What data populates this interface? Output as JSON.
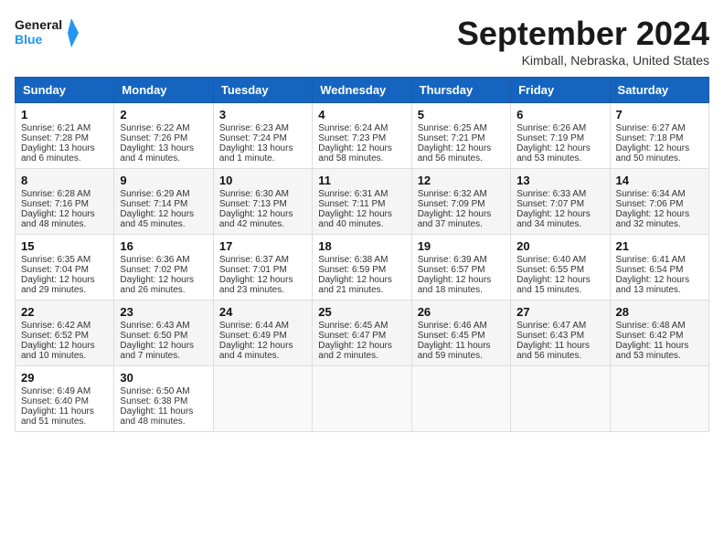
{
  "header": {
    "logo_line1": "General",
    "logo_line2": "Blue",
    "month": "September 2024",
    "location": "Kimball, Nebraska, United States"
  },
  "days_of_week": [
    "Sunday",
    "Monday",
    "Tuesday",
    "Wednesday",
    "Thursday",
    "Friday",
    "Saturday"
  ],
  "weeks": [
    [
      {
        "day": "1",
        "sunrise": "Sunrise: 6:21 AM",
        "sunset": "Sunset: 7:28 PM",
        "daylight": "Daylight: 13 hours and 6 minutes."
      },
      {
        "day": "2",
        "sunrise": "Sunrise: 6:22 AM",
        "sunset": "Sunset: 7:26 PM",
        "daylight": "Daylight: 13 hours and 4 minutes."
      },
      {
        "day": "3",
        "sunrise": "Sunrise: 6:23 AM",
        "sunset": "Sunset: 7:24 PM",
        "daylight": "Daylight: 13 hours and 1 minute."
      },
      {
        "day": "4",
        "sunrise": "Sunrise: 6:24 AM",
        "sunset": "Sunset: 7:23 PM",
        "daylight": "Daylight: 12 hours and 58 minutes."
      },
      {
        "day": "5",
        "sunrise": "Sunrise: 6:25 AM",
        "sunset": "Sunset: 7:21 PM",
        "daylight": "Daylight: 12 hours and 56 minutes."
      },
      {
        "day": "6",
        "sunrise": "Sunrise: 6:26 AM",
        "sunset": "Sunset: 7:19 PM",
        "daylight": "Daylight: 12 hours and 53 minutes."
      },
      {
        "day": "7",
        "sunrise": "Sunrise: 6:27 AM",
        "sunset": "Sunset: 7:18 PM",
        "daylight": "Daylight: 12 hours and 50 minutes."
      }
    ],
    [
      {
        "day": "8",
        "sunrise": "Sunrise: 6:28 AM",
        "sunset": "Sunset: 7:16 PM",
        "daylight": "Daylight: 12 hours and 48 minutes."
      },
      {
        "day": "9",
        "sunrise": "Sunrise: 6:29 AM",
        "sunset": "Sunset: 7:14 PM",
        "daylight": "Daylight: 12 hours and 45 minutes."
      },
      {
        "day": "10",
        "sunrise": "Sunrise: 6:30 AM",
        "sunset": "Sunset: 7:13 PM",
        "daylight": "Daylight: 12 hours and 42 minutes."
      },
      {
        "day": "11",
        "sunrise": "Sunrise: 6:31 AM",
        "sunset": "Sunset: 7:11 PM",
        "daylight": "Daylight: 12 hours and 40 minutes."
      },
      {
        "day": "12",
        "sunrise": "Sunrise: 6:32 AM",
        "sunset": "Sunset: 7:09 PM",
        "daylight": "Daylight: 12 hours and 37 minutes."
      },
      {
        "day": "13",
        "sunrise": "Sunrise: 6:33 AM",
        "sunset": "Sunset: 7:07 PM",
        "daylight": "Daylight: 12 hours and 34 minutes."
      },
      {
        "day": "14",
        "sunrise": "Sunrise: 6:34 AM",
        "sunset": "Sunset: 7:06 PM",
        "daylight": "Daylight: 12 hours and 32 minutes."
      }
    ],
    [
      {
        "day": "15",
        "sunrise": "Sunrise: 6:35 AM",
        "sunset": "Sunset: 7:04 PM",
        "daylight": "Daylight: 12 hours and 29 minutes."
      },
      {
        "day": "16",
        "sunrise": "Sunrise: 6:36 AM",
        "sunset": "Sunset: 7:02 PM",
        "daylight": "Daylight: 12 hours and 26 minutes."
      },
      {
        "day": "17",
        "sunrise": "Sunrise: 6:37 AM",
        "sunset": "Sunset: 7:01 PM",
        "daylight": "Daylight: 12 hours and 23 minutes."
      },
      {
        "day": "18",
        "sunrise": "Sunrise: 6:38 AM",
        "sunset": "Sunset: 6:59 PM",
        "daylight": "Daylight: 12 hours and 21 minutes."
      },
      {
        "day": "19",
        "sunrise": "Sunrise: 6:39 AM",
        "sunset": "Sunset: 6:57 PM",
        "daylight": "Daylight: 12 hours and 18 minutes."
      },
      {
        "day": "20",
        "sunrise": "Sunrise: 6:40 AM",
        "sunset": "Sunset: 6:55 PM",
        "daylight": "Daylight: 12 hours and 15 minutes."
      },
      {
        "day": "21",
        "sunrise": "Sunrise: 6:41 AM",
        "sunset": "Sunset: 6:54 PM",
        "daylight": "Daylight: 12 hours and 13 minutes."
      }
    ],
    [
      {
        "day": "22",
        "sunrise": "Sunrise: 6:42 AM",
        "sunset": "Sunset: 6:52 PM",
        "daylight": "Daylight: 12 hours and 10 minutes."
      },
      {
        "day": "23",
        "sunrise": "Sunrise: 6:43 AM",
        "sunset": "Sunset: 6:50 PM",
        "daylight": "Daylight: 12 hours and 7 minutes."
      },
      {
        "day": "24",
        "sunrise": "Sunrise: 6:44 AM",
        "sunset": "Sunset: 6:49 PM",
        "daylight": "Daylight: 12 hours and 4 minutes."
      },
      {
        "day": "25",
        "sunrise": "Sunrise: 6:45 AM",
        "sunset": "Sunset: 6:47 PM",
        "daylight": "Daylight: 12 hours and 2 minutes."
      },
      {
        "day": "26",
        "sunrise": "Sunrise: 6:46 AM",
        "sunset": "Sunset: 6:45 PM",
        "daylight": "Daylight: 11 hours and 59 minutes."
      },
      {
        "day": "27",
        "sunrise": "Sunrise: 6:47 AM",
        "sunset": "Sunset: 6:43 PM",
        "daylight": "Daylight: 11 hours and 56 minutes."
      },
      {
        "day": "28",
        "sunrise": "Sunrise: 6:48 AM",
        "sunset": "Sunset: 6:42 PM",
        "daylight": "Daylight: 11 hours and 53 minutes."
      }
    ],
    [
      {
        "day": "29",
        "sunrise": "Sunrise: 6:49 AM",
        "sunset": "Sunset: 6:40 PM",
        "daylight": "Daylight: 11 hours and 51 minutes."
      },
      {
        "day": "30",
        "sunrise": "Sunrise: 6:50 AM",
        "sunset": "Sunset: 6:38 PM",
        "daylight": "Daylight: 11 hours and 48 minutes."
      },
      null,
      null,
      null,
      null,
      null
    ]
  ]
}
